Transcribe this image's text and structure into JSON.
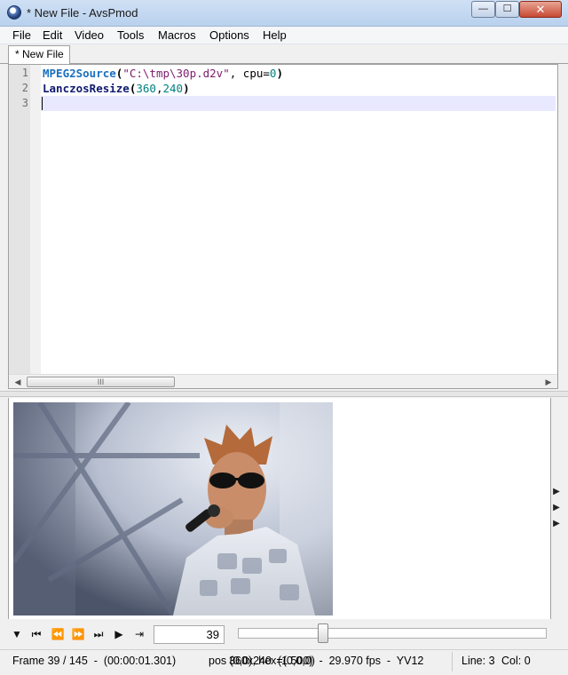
{
  "window": {
    "title": "* New File - AvsPmod",
    "buttons": {
      "minimize": "—",
      "maximize": "☐",
      "close": "✕"
    }
  },
  "menu": [
    "File",
    "Edit",
    "Video",
    "Tools",
    "Macros",
    "Options",
    "Help"
  ],
  "tabs": [
    {
      "label": "* New File"
    }
  ],
  "editor": {
    "line_numbers": [
      "1",
      "2",
      "3"
    ],
    "line1": {
      "fn": "MPEG2Source",
      "open": "(",
      "str": "\"C:\\tmp\\30p.d2v\"",
      "sep": ", cpu",
      "eq": "=",
      "num": "0",
      "close": ")"
    },
    "line2": {
      "fn": "LanczosResize",
      "open": "(",
      "num1": "360",
      "comma": ",",
      "num2": "240",
      "close": ")"
    },
    "line3": "",
    "hscroll_grip": "III"
  },
  "side_arrows": [
    "▶",
    "▶",
    "▶"
  ],
  "controls": {
    "frame_value": "39",
    "slider_fraction": 0.269,
    "icons": [
      "triangle-down-icon",
      "skip-first-icon",
      "step-back-icon",
      "step-forward-icon",
      "skip-last-icon",
      "play-icon",
      "cursor-frame-icon"
    ]
  },
  "status": {
    "frame": "Frame 39 / 145  -  (00:00:01.301)",
    "pos": "pos (0,0), hex=(0,0,0)",
    "overlay": "360x240  (1.500)  -  29.970 fps  -  YV12",
    "line": "Line: 3",
    "col": "Col: 0"
  },
  "colors": {
    "function_blue": "#1c6fbf",
    "function_navy": "#0f1a6e",
    "string_purple": "#7d1b6e",
    "number_teal": "#008080",
    "current_line": "#e8e8ff"
  }
}
